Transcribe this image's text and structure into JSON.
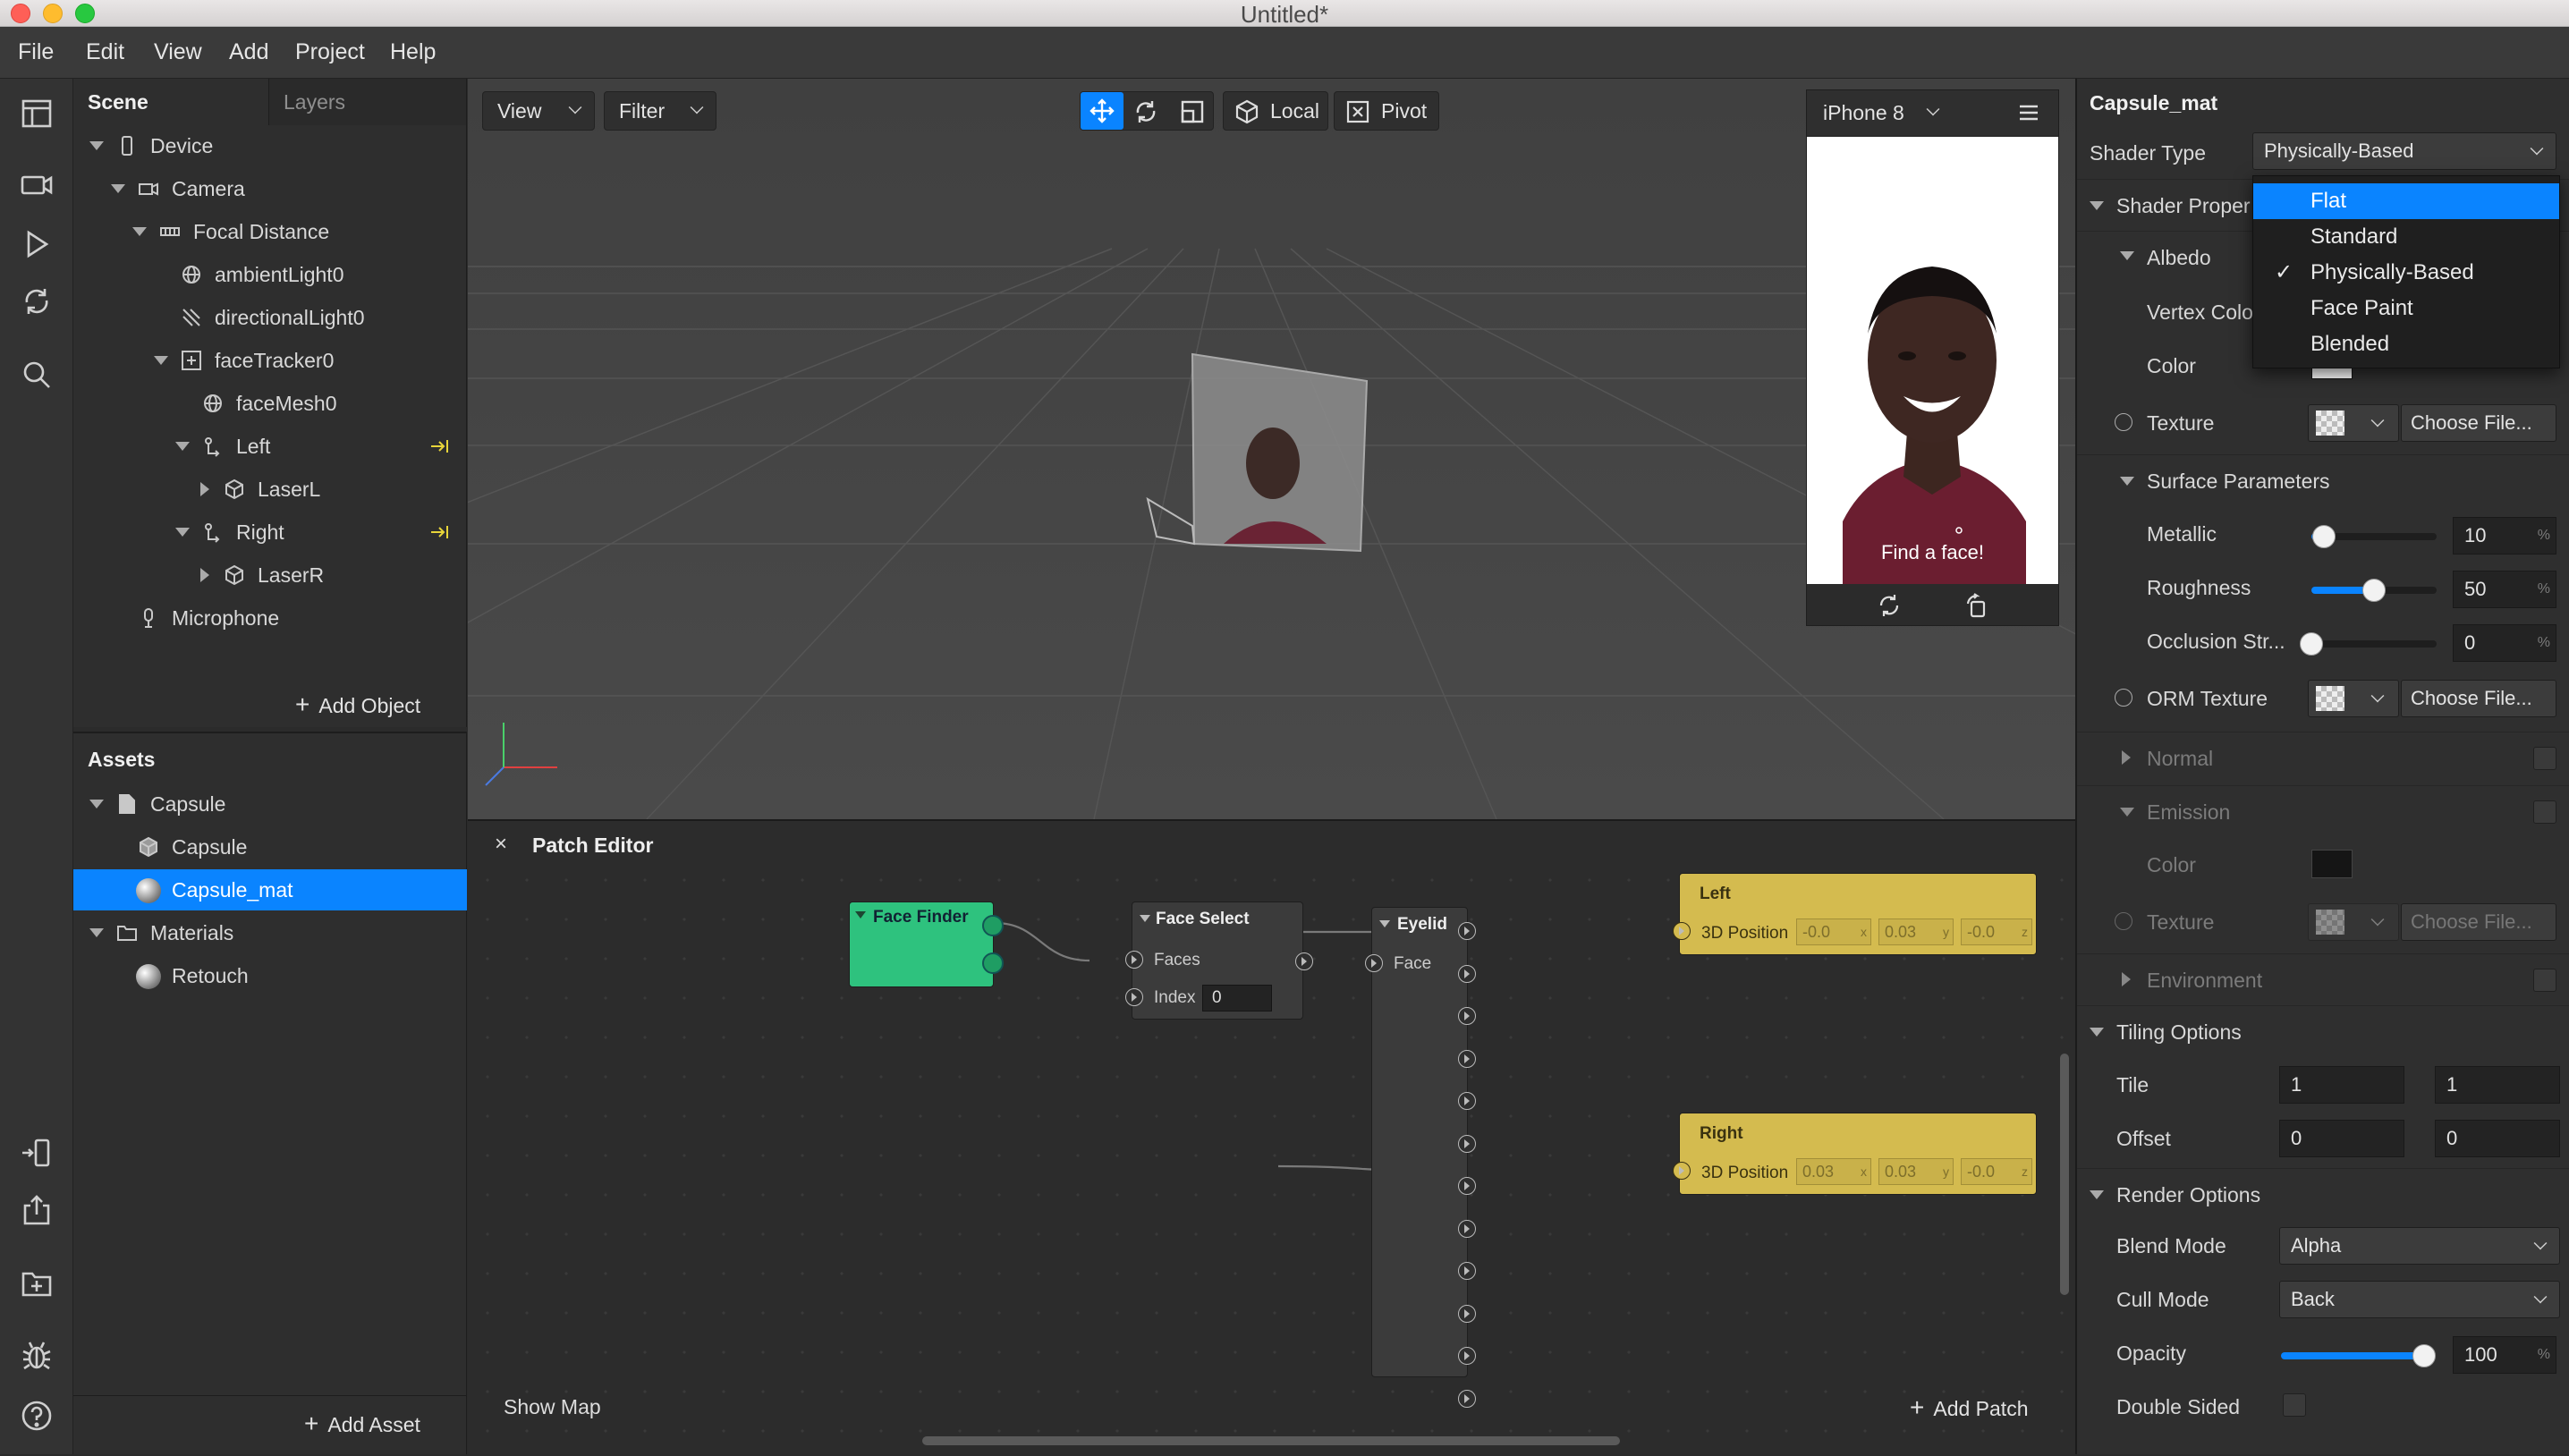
{
  "window": {
    "title": "Untitled*"
  },
  "menu": [
    "File",
    "Edit",
    "View",
    "Add",
    "Project",
    "Help"
  ],
  "left_toolbar": [
    "layout-icon",
    "video-camera-icon",
    "play-icon",
    "sync-icon",
    "search-icon",
    "mirror-device-icon",
    "share-icon",
    "add-folder-icon",
    "bug-icon",
    "help-icon"
  ],
  "scene": {
    "tabs": [
      "Scene",
      "Layers"
    ],
    "items": [
      "Device",
      "Camera",
      "Focal Distance",
      "ambientLight0",
      "directionalLight0",
      "faceTracker0",
      "faceMesh0",
      "Left",
      "LaserL",
      "Right",
      "LaserR",
      "Microphone"
    ],
    "add_label": "Add Object"
  },
  "assets": {
    "title": "Assets",
    "items": [
      "Capsule",
      "Capsule",
      "Capsule_mat",
      "Materials",
      "Retouch"
    ],
    "add_label": "Add Asset"
  },
  "viewport": {
    "view_label": "View",
    "filter_label": "Filter",
    "local_label": "Local",
    "pivot_label": "Pivot",
    "device": "iPhone 8",
    "preview_caption": "Find a face!"
  },
  "patch_editor": {
    "title": "Patch Editor",
    "show_map": "Show Map",
    "add_patch": "Add Patch",
    "face_finder": "Face Finder",
    "face_select": {
      "title": "Face Select",
      "faces": "Faces",
      "index": "Index",
      "index_value": "0"
    },
    "eyelid": {
      "title": "Eyelid",
      "face": "Face"
    },
    "left": {
      "title": "Left",
      "port": "3D Position",
      "x": "-0.0",
      "y": "0.03",
      "z": "-0.0"
    },
    "right": {
      "title": "Right",
      "port": "3D Position",
      "x": "0.03",
      "y": "0.03",
      "z": "-0.0"
    },
    "axes": [
      "x",
      "y",
      "z"
    ]
  },
  "inspector": {
    "title": "Capsule_mat",
    "shader_type_label": "Shader Type",
    "shader_type_value": "Physically-Based",
    "shader_properties": "Shader Proper",
    "albedo": "Albedo",
    "vertex_color": "Vertex Colo",
    "color": "Color",
    "texture": "Texture",
    "choose_file": "Choose File...",
    "surface_parameters": "Surface Parameters",
    "metallic": {
      "label": "Metallic",
      "value": "10",
      "unit": "%"
    },
    "roughness": {
      "label": "Roughness",
      "value": "50",
      "unit": "%"
    },
    "occlusion": {
      "label": "Occlusion Str...",
      "value": "0",
      "unit": "%"
    },
    "orm_texture": "ORM Texture",
    "normal": "Normal",
    "emission": "Emission",
    "emission_color": "Color",
    "emission_texture": "Texture",
    "environment": "Environment",
    "tiling_options": "Tiling Options",
    "tile": {
      "label": "Tile",
      "u": "1",
      "v": "1"
    },
    "offset": {
      "label": "Offset",
      "u": "0",
      "v": "0"
    },
    "render_options": "Render Options",
    "blend_mode": {
      "label": "Blend Mode",
      "value": "Alpha"
    },
    "cull_mode": {
      "label": "Cull Mode",
      "value": "Back"
    },
    "opacity": {
      "label": "Opacity",
      "value": "100",
      "unit": "%"
    },
    "double_sided": "Double Sided"
  },
  "shader_dropdown": {
    "options": [
      "Flat",
      "Standard",
      "Physically-Based",
      "Face Paint",
      "Blended"
    ],
    "selected": "Physically-Based",
    "highlighted": "Flat",
    "check": "✓"
  },
  "colors": {
    "accent": "#0a84ff",
    "node_green": "#2ec27e",
    "node_yellow": "#d4bb4f",
    "selection": "#0a84ff"
  },
  "levels": {
    "metallic": 0.1,
    "roughness": 0.5,
    "occlusion": 0.0,
    "opacity": 1.0
  }
}
